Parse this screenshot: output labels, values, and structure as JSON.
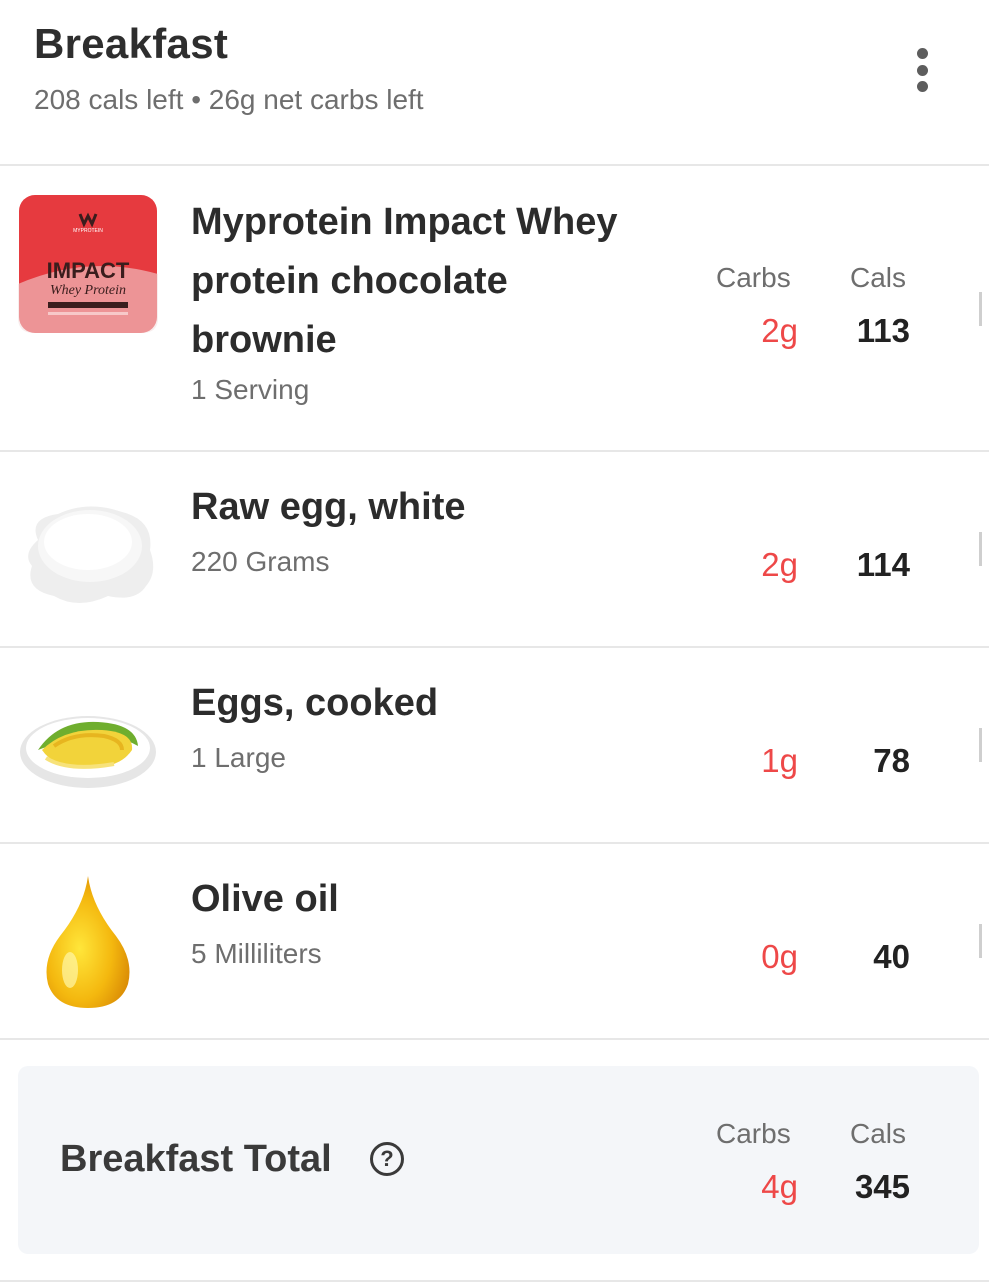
{
  "header": {
    "title": "Breakfast",
    "subtitle": "208 cals left • 26g net carbs left"
  },
  "columns": {
    "carbs": "Carbs",
    "cals": "Cals"
  },
  "items": [
    {
      "name": "Myprotein Impact Whey protein chocolate brownie",
      "serving": "1 Serving",
      "carbs": "2g",
      "cals": "113",
      "icon": "protein-package-icon",
      "package_text": {
        "brand": "MYPROTEIN",
        "product": "IMPACT",
        "type": "Whey Protein"
      }
    },
    {
      "name": "Raw egg, white",
      "serving": "220 Grams",
      "carbs": "2g",
      "cals": "114",
      "icon": "egg-white-icon"
    },
    {
      "name": "Eggs, cooked",
      "serving": "1 Large",
      "carbs": "1g",
      "cals": "78",
      "icon": "cooked-egg-plate-icon"
    },
    {
      "name": "Olive oil",
      "serving": "5 Milliliters",
      "carbs": "0g",
      "cals": "40",
      "icon": "oil-drop-icon"
    }
  ],
  "total": {
    "label": "Breakfast Total",
    "help": "?",
    "carbs": "4g",
    "cals": "345"
  },
  "colors": {
    "carbs": "#ee4848",
    "accent_bg": "#f4f6f9",
    "divider": "#e7e7e7"
  }
}
